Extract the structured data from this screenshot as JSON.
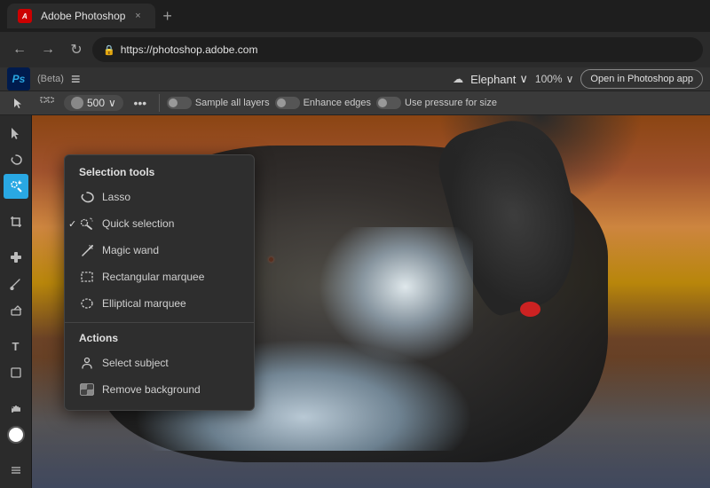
{
  "browser": {
    "tab_title": "Adobe Photoshop",
    "url": "https://photoshop.adobe.com",
    "tab_close": "×",
    "tab_new": "+",
    "nav_back": "←",
    "nav_forward": "→",
    "nav_refresh": "↻",
    "lock_icon": "🔒"
  },
  "ps_header": {
    "logo": "Ps",
    "beta_label": "(Beta)",
    "menu_icon": "≡",
    "cloud_icon": "☁",
    "filename": "Elephant",
    "filename_chevron": "∨",
    "zoom": "100%",
    "zoom_chevron": "∨",
    "open_btn": "Open in Photoshop app"
  },
  "ps_toolbar": {
    "brush_size": "500",
    "chevron": "∨",
    "more_options": "•••",
    "sample_layers_label": "Sample all layers",
    "enhance_edges_label": "Enhance edges",
    "pressure_label": "Use pressure for size"
  },
  "selection_tools": {
    "section_title": "Selection tools",
    "items": [
      {
        "id": "lasso",
        "label": "Lasso",
        "icon": "lasso",
        "checked": false
      },
      {
        "id": "quick-selection",
        "label": "Quick selection",
        "icon": "quick-sel",
        "checked": true
      },
      {
        "id": "magic-wand",
        "label": "Magic wand",
        "icon": "magic-wand",
        "checked": false
      },
      {
        "id": "rectangular-marquee",
        "label": "Rectangular marquee",
        "icon": "rect-marquee",
        "checked": false
      },
      {
        "id": "elliptical-marquee",
        "label": "Elliptical marquee",
        "icon": "ellip-marquee",
        "checked": false
      }
    ]
  },
  "actions": {
    "section_title": "Actions",
    "items": [
      {
        "id": "select-subject",
        "label": "Select subject",
        "icon": "select-subject"
      },
      {
        "id": "remove-background",
        "label": "Remove background",
        "icon": "remove-bg"
      }
    ]
  },
  "left_tools": [
    {
      "id": "select",
      "icon": "▶",
      "active": false
    },
    {
      "id": "lasso-tool",
      "icon": "⌒",
      "active": false
    },
    {
      "id": "quick-select",
      "icon": "⊕",
      "active": true
    },
    {
      "id": "crop",
      "icon": "⊡",
      "active": false
    },
    {
      "id": "healing",
      "icon": "✚",
      "active": false
    },
    {
      "id": "brush",
      "icon": "✏",
      "active": false
    },
    {
      "id": "eraser",
      "icon": "◻",
      "active": false
    },
    {
      "id": "paint-bucket",
      "icon": "▲",
      "active": false
    },
    {
      "id": "type",
      "icon": "T",
      "active": false
    },
    {
      "id": "shape",
      "icon": "◇",
      "active": false
    },
    {
      "id": "hand",
      "icon": "✋",
      "active": false
    },
    {
      "id": "zoom",
      "icon": "⊙",
      "active": false
    }
  ]
}
